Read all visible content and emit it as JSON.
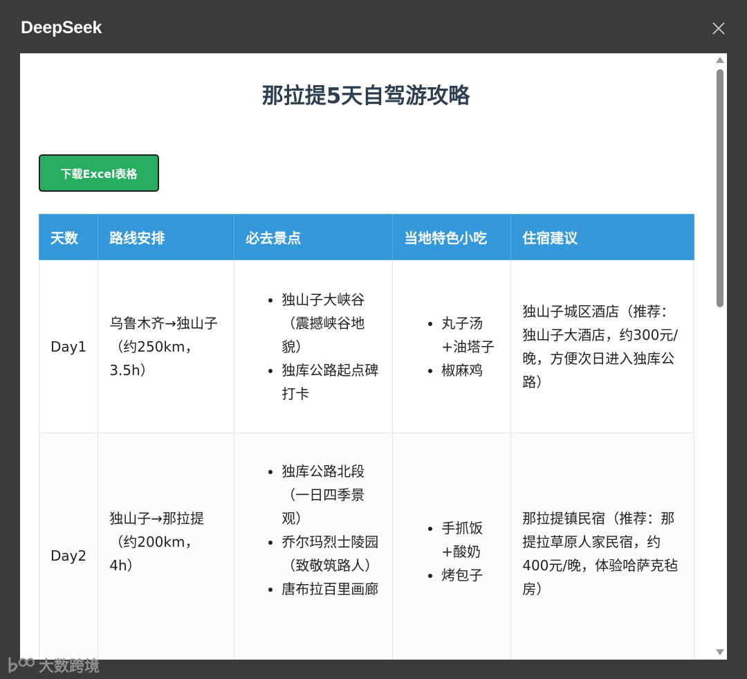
{
  "window": {
    "title": "DeepSeek"
  },
  "page": {
    "title": "那拉提5天自驾游攻略",
    "download_label": "下载Excel表格"
  },
  "table": {
    "headers": [
      "天数",
      "路线安排",
      "必去景点",
      "当地特色小吃",
      "住宿建议"
    ],
    "rows": [
      {
        "day": "Day1",
        "route": "乌鲁木齐→独山子（约250km，3.5h）",
        "spots": [
          "独山子大峡谷（震撼峡谷地貌）",
          "独库公路起点碑打卡"
        ],
        "food": [
          "丸子汤+油塔子",
          "椒麻鸡"
        ],
        "stay": "独山子城区酒店（推荐：独山子大酒店，约300元/晚，方便次日进入独库公路）"
      },
      {
        "day": "Day2",
        "route": "独山子→那拉提（约200km，4h）",
        "spots": [
          "独库公路北段（一日四季景观）",
          "乔尔玛烈士陵园（致敬筑路人）",
          "唐布拉百里画廊"
        ],
        "food": [
          "手抓饭+酸奶",
          "烤包子"
        ],
        "stay": "那拉提镇民宿（推荐：那提拉草原人家民宿，约400元/晚，体验哈萨克毡房）"
      }
    ]
  },
  "watermark": {
    "text": "大数跨境",
    "icon": "brand-logo-icon"
  },
  "icons": {
    "close": "close-icon"
  },
  "colors": {
    "header_bg": "#3498db",
    "button_bg": "#27ae60",
    "title_text": "#2c3e50",
    "chrome_bg": "#3b3b3b"
  }
}
